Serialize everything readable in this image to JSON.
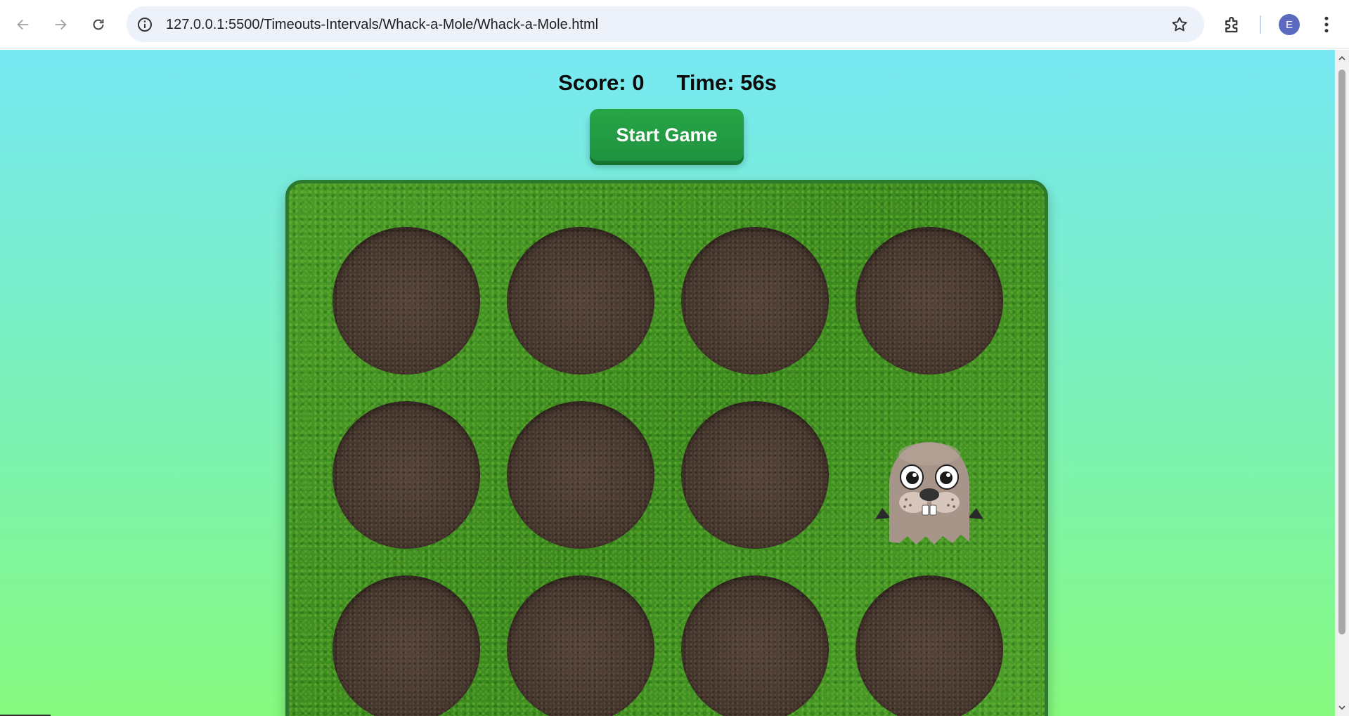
{
  "browser": {
    "url": "127.0.0.1:5500/Timeouts-Intervals/Whack-a-Mole/Whack-a-Mole.html",
    "avatar_letter": "E"
  },
  "game": {
    "score_label": "Score: 0",
    "time_label": "Time: 56s",
    "start_button_label": "Start Game",
    "holes": [
      {
        "row": 1,
        "col": 1,
        "has_mole": false
      },
      {
        "row": 1,
        "col": 2,
        "has_mole": false
      },
      {
        "row": 1,
        "col": 3,
        "has_mole": false
      },
      {
        "row": 1,
        "col": 4,
        "has_mole": false
      },
      {
        "row": 2,
        "col": 1,
        "has_mole": false
      },
      {
        "row": 2,
        "col": 2,
        "has_mole": false
      },
      {
        "row": 2,
        "col": 3,
        "has_mole": false
      },
      {
        "row": 2,
        "col": 4,
        "has_mole": true
      },
      {
        "row": 3,
        "col": 1,
        "has_mole": false
      },
      {
        "row": 3,
        "col": 2,
        "has_mole": false
      },
      {
        "row": 3,
        "col": 3,
        "has_mole": false
      },
      {
        "row": 3,
        "col": 4,
        "has_mole": false
      }
    ],
    "colors": {
      "button": "#27a546",
      "board_border": "#2b7a2d",
      "soil": "#4a3a30"
    }
  },
  "icons": {
    "back": "arrow-left-icon",
    "forward": "arrow-right-icon",
    "reload": "reload-icon",
    "info": "info-icon",
    "bookmark": "star-icon",
    "extensions": "puzzle-icon",
    "menu": "kebab-menu-icon",
    "mole": "mole-icon"
  }
}
